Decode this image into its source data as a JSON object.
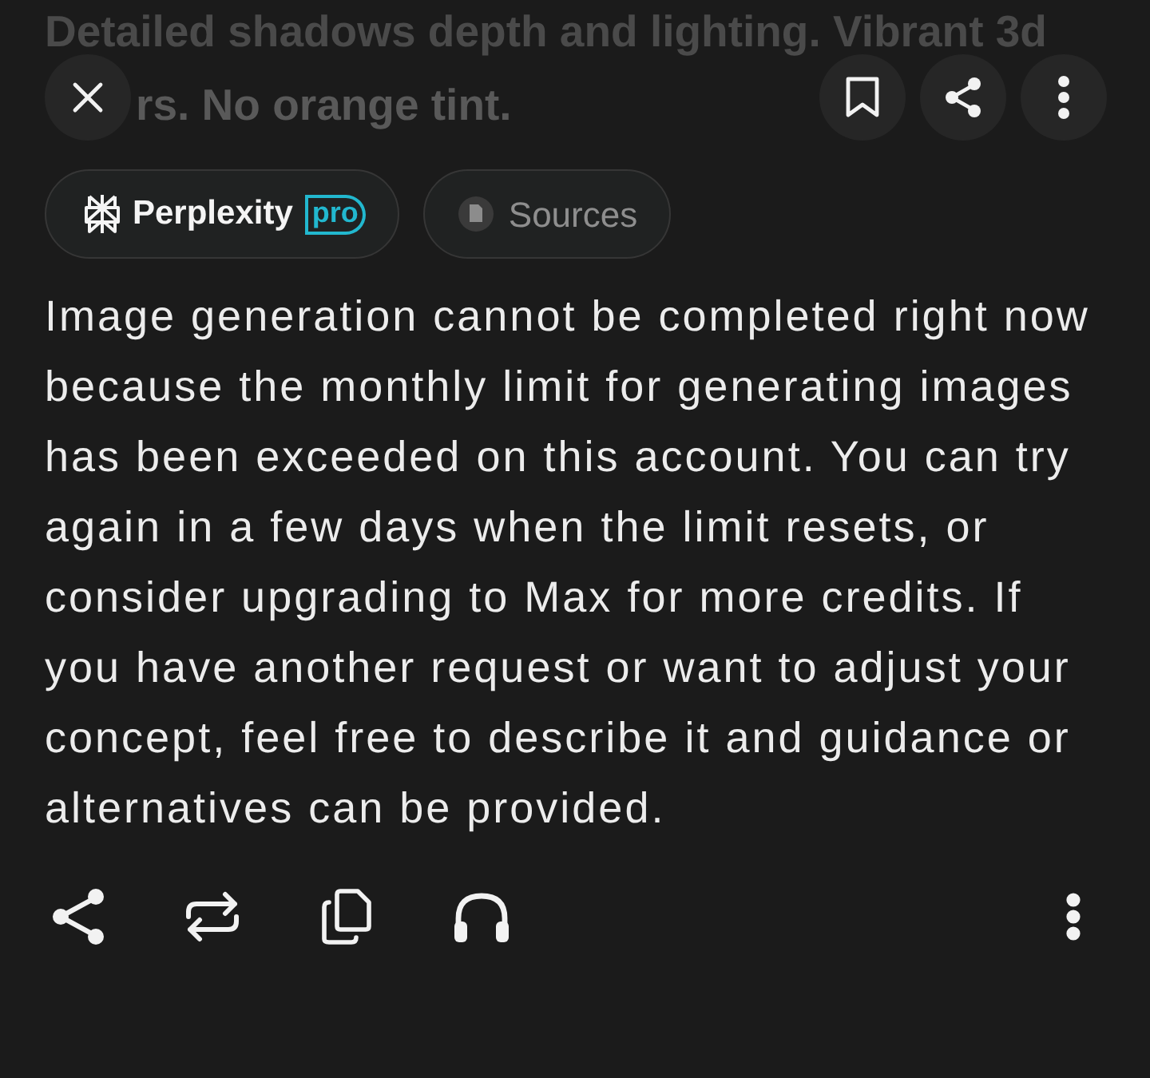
{
  "query": {
    "lines": [
      "Detailed shadows depth and lighting. Vibrant 3d",
      "rs. No orange tint."
    ]
  },
  "chips": [
    {
      "kind": "model",
      "label": "Perplexity",
      "badge": "pro"
    },
    {
      "kind": "sources",
      "label": "Sources"
    }
  ],
  "answer": "Image generation cannot be completed right now because the monthly limit for generating images has been exceeded on this account. You can try again in a few days when the limit resets, or consider upgrading to Max for more credits. If you have another request or want to adjust your concept, feel free to describe it and guidance or alternatives can be provided."
}
